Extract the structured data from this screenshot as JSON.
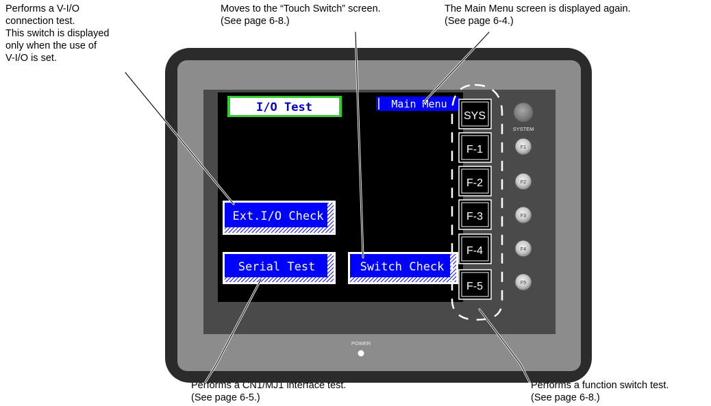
{
  "callouts": {
    "vio": [
      "Performs a V-I/O",
      "connection test.",
      "This switch is displayed",
      "only when the use of",
      "V-I/O is set."
    ],
    "touch_switch": [
      "Moves to the “Touch Switch” screen.",
      "(See page 6-8.)"
    ],
    "main_menu": [
      "The Main Menu screen is displayed again.",
      "(See page 6-4.)"
    ],
    "cn1": [
      "Performs a CN1/MJ1 interface test.",
      "(See page 6-5.)"
    ],
    "function_switch": [
      "Performs a function switch test.",
      "(See page 6-8.)"
    ]
  },
  "screen": {
    "title": "I/O Test",
    "main_menu_label": "Main Menu",
    "ext_io_label": "Ext.I/O Check",
    "serial_label": "Serial Test",
    "switch_label": "Switch Check"
  },
  "function_keys": [
    "SYS",
    "F-1",
    "F-2",
    "F-3",
    "F-4",
    "F-5"
  ],
  "hard_buttons": {
    "system_label": "SYSTEM",
    "keys": [
      "F1",
      "F2",
      "F3",
      "F4",
      "F5"
    ]
  },
  "power_label": "POWER",
  "colors": {
    "bezel_outer": "#2b2b2b",
    "bezel_inner": "#8c8c8c",
    "screen_bg": "#000000",
    "button_blue": "#0000ff",
    "title_border": "#33cc33"
  }
}
